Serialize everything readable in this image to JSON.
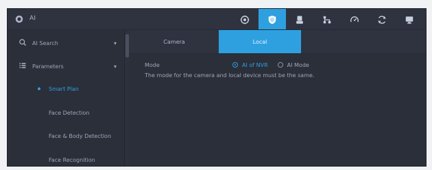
{
  "app": {
    "title": "AI"
  },
  "topbar": {
    "icons": [
      {
        "name": "target-icon",
        "active": false
      },
      {
        "name": "shield-icon",
        "active": true
      },
      {
        "name": "user-icon",
        "active": false
      },
      {
        "name": "network-icon",
        "active": false
      },
      {
        "name": "gauge-icon",
        "active": false
      },
      {
        "name": "refresh-icon",
        "active": false
      },
      {
        "name": "monitor-icon",
        "active": false
      }
    ]
  },
  "sidebar": {
    "items": [
      {
        "label": "AI Search",
        "icon": "search-icon",
        "expanded": false
      },
      {
        "label": "Parameters",
        "icon": "list-icon",
        "expanded": true
      }
    ],
    "sub_items": [
      {
        "label": "Smart Plan",
        "active": true
      },
      {
        "label": "Face Detection",
        "active": false
      },
      {
        "label": "Face & Body Detection",
        "active": false
      },
      {
        "label": "Face Recognition",
        "active": false
      }
    ]
  },
  "tabs": [
    {
      "label": "Camera",
      "active": false
    },
    {
      "label": "Local",
      "active": true
    }
  ],
  "form": {
    "mode_label": "Mode",
    "options": [
      {
        "label": "AI of NVR",
        "selected": true
      },
      {
        "label": "AI Mode",
        "selected": false
      }
    ],
    "note": "The mode for the camera and local device must be the same."
  },
  "colors": {
    "accent": "#2ea0e0",
    "bg": "#2b2f3a",
    "bar": "#2f3340",
    "text": "#9ea6b8"
  }
}
